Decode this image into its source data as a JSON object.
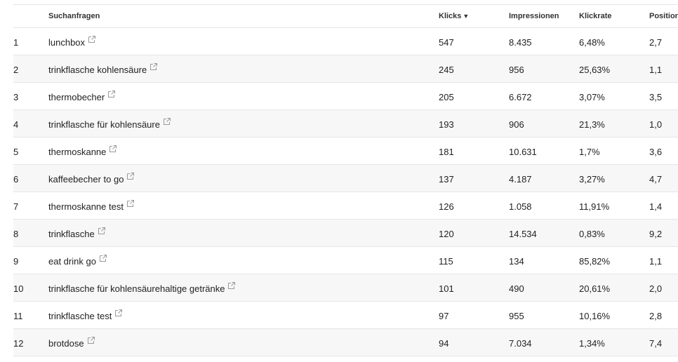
{
  "table": {
    "headers": {
      "number": "",
      "query": "Suchanfragen",
      "clicks": "Klicks",
      "clicks_sort": "▼",
      "impressions": "Impressionen",
      "ctr": "Klickrate",
      "position": "Position"
    },
    "rows": [
      {
        "num": "1",
        "query": "lunchbox",
        "clicks": "547",
        "impressions": "8.435",
        "ctr": "6,48%",
        "position": "2,7"
      },
      {
        "num": "2",
        "query": "trinkflasche kohlensäure",
        "clicks": "245",
        "impressions": "956",
        "ctr": "25,63%",
        "position": "1,1"
      },
      {
        "num": "3",
        "query": "thermobecher",
        "clicks": "205",
        "impressions": "6.672",
        "ctr": "3,07%",
        "position": "3,5"
      },
      {
        "num": "4",
        "query": "trinkflasche für kohlensäure",
        "clicks": "193",
        "impressions": "906",
        "ctr": "21,3%",
        "position": "1,0"
      },
      {
        "num": "5",
        "query": "thermoskanne",
        "clicks": "181",
        "impressions": "10.631",
        "ctr": "1,7%",
        "position": "3,6"
      },
      {
        "num": "6",
        "query": "kaffeebecher to go",
        "clicks": "137",
        "impressions": "4.187",
        "ctr": "3,27%",
        "position": "4,7"
      },
      {
        "num": "7",
        "query": "thermoskanne test",
        "clicks": "126",
        "impressions": "1.058",
        "ctr": "11,91%",
        "position": "1,4"
      },
      {
        "num": "8",
        "query": "trinkflasche",
        "clicks": "120",
        "impressions": "14.534",
        "ctr": "0,83%",
        "position": "9,2"
      },
      {
        "num": "9",
        "query": "eat drink go",
        "clicks": "115",
        "impressions": "134",
        "ctr": "85,82%",
        "position": "1,1"
      },
      {
        "num": "10",
        "query": "trinkflasche für kohlensäurehaltige getränke",
        "clicks": "101",
        "impressions": "490",
        "ctr": "20,61%",
        "position": "2,0"
      },
      {
        "num": "11",
        "query": "trinkflasche test",
        "clicks": "97",
        "impressions": "955",
        "ctr": "10,16%",
        "position": "2,8"
      },
      {
        "num": "12",
        "query": "brotdose",
        "clicks": "94",
        "impressions": "7.034",
        "ctr": "1,34%",
        "position": "7,4"
      }
    ]
  },
  "icons": {
    "external_link": "external-link-icon"
  },
  "colors": {
    "row_alt": "#f7f7f7",
    "border": "#e6e6e6",
    "text": "#222222",
    "icon": "#999999"
  }
}
